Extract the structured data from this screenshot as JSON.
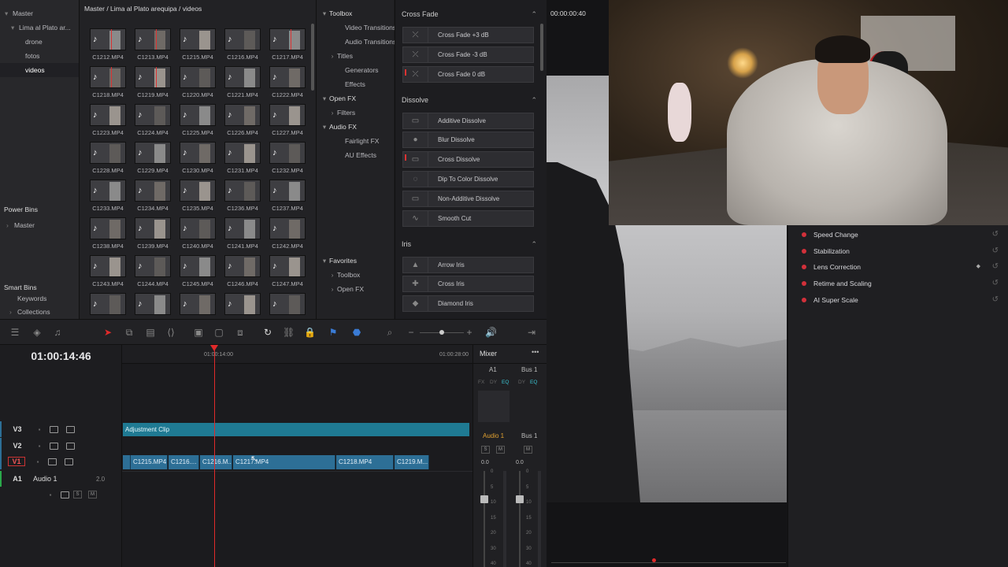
{
  "bins": {
    "items": [
      {
        "label": "Master",
        "level": 0,
        "chev": "▾"
      },
      {
        "label": "Lima al Plato ar...",
        "level": 1,
        "chev": "▾"
      },
      {
        "label": "drone",
        "level": 2,
        "chev": ""
      },
      {
        "label": "fotos",
        "level": 2,
        "chev": ""
      },
      {
        "label": "videos",
        "level": 2,
        "chev": "",
        "selected": true
      }
    ],
    "power_bins": "Power Bins",
    "power_master": "Master",
    "smart_bins": "Smart Bins",
    "keywords": "Keywords",
    "collections": "Collections"
  },
  "media": {
    "breadcrumb": "Master / Lima al Plato arequipa / videos",
    "clips": [
      "C1212.MP4",
      "C1213.MP4",
      "C1215.MP4",
      "C1216.MP4",
      "C1217.MP4",
      "C1218.MP4",
      "C1219.MP4",
      "C1220.MP4",
      "C1221.MP4",
      "C1222.MP4",
      "C1223.MP4",
      "C1224.MP4",
      "C1225.MP4",
      "C1226.MP4",
      "C1227.MP4",
      "C1228.MP4",
      "C1229.MP4",
      "C1230.MP4",
      "C1231.MP4",
      "C1232.MP4",
      "C1233.MP4",
      "C1234.MP4",
      "C1235.MP4",
      "C1236.MP4",
      "C1237.MP4",
      "C1238.MP4",
      "C1239.MP4",
      "C1240.MP4",
      "C1241.MP4",
      "C1242.MP4",
      "C1243.MP4",
      "C1244.MP4",
      "C1245.MP4",
      "C1246.MP4",
      "C1247.MP4",
      "",
      "",
      "",
      "",
      ""
    ]
  },
  "toolbox": {
    "items": [
      {
        "label": "Toolbox",
        "chev": "▾",
        "indent": 0
      },
      {
        "label": "Video Transitions",
        "chev": "",
        "indent": 2
      },
      {
        "label": "Audio Transitions",
        "chev": "",
        "indent": 2
      },
      {
        "label": "Titles",
        "chev": "›",
        "indent": 1
      },
      {
        "label": "Generators",
        "chev": "",
        "indent": 2
      },
      {
        "label": "Effects",
        "chev": "",
        "indent": 2
      },
      {
        "label": "Open FX",
        "chev": "▾",
        "indent": 0
      },
      {
        "label": "Filters",
        "chev": "›",
        "indent": 1
      },
      {
        "label": "Audio FX",
        "chev": "▾",
        "indent": 0
      },
      {
        "label": "Fairlight FX",
        "chev": "",
        "indent": 2
      },
      {
        "label": "AU Effects",
        "chev": "",
        "indent": 2
      }
    ],
    "favorites": [
      {
        "label": "Favorites",
        "chev": "▾",
        "indent": 0
      },
      {
        "label": "Toolbox",
        "chev": "›",
        "indent": 1
      },
      {
        "label": "Open FX",
        "chev": "›",
        "indent": 1
      }
    ]
  },
  "effects": {
    "sections": [
      {
        "title": "Cross Fade",
        "items": [
          {
            "label": "Cross Fade +3 dB",
            "icon": "⤫"
          },
          {
            "label": "Cross Fade -3 dB",
            "icon": "⤫"
          },
          {
            "label": "Cross Fade 0 dB",
            "icon": "⤫",
            "fav": true
          }
        ]
      },
      {
        "title": "Dissolve",
        "items": [
          {
            "label": "Additive Dissolve",
            "icon": "▭"
          },
          {
            "label": "Blur Dissolve",
            "icon": "●"
          },
          {
            "label": "Cross Dissolve",
            "icon": "▭",
            "fav": true
          },
          {
            "label": "Dip To Color Dissolve",
            "icon": "◌"
          },
          {
            "label": "Non-Additive Dissolve",
            "icon": "▭"
          },
          {
            "label": "Smooth Cut",
            "icon": "∿"
          }
        ]
      },
      {
        "title": "Iris",
        "items": [
          {
            "label": "Arrow Iris",
            "icon": "▲"
          },
          {
            "label": "Cross Iris",
            "icon": "✚"
          },
          {
            "label": "Diamond Iris",
            "icon": "◆"
          }
        ]
      }
    ]
  },
  "timeline": {
    "timecode": "01:00:14:46",
    "ruler_marks": [
      "01:00:14:00",
      "01:00:28:00"
    ],
    "tracks": [
      {
        "name": "V3",
        "label": ""
      },
      {
        "name": "V2",
        "label": ""
      },
      {
        "name": "V1",
        "label": ""
      },
      {
        "name": "A1",
        "label": "Audio 1",
        "value": "2.0"
      }
    ],
    "adjustment_clip": "Adjustment Clip",
    "clips": [
      "C1215.MP4",
      "C1216....",
      "C1216.M...",
      "C1217.MP4",
      "C1218.MP4",
      "C1219.M..."
    ],
    "audio_buttons": {
      "s": "S",
      "m": "M"
    }
  },
  "mixer": {
    "title": "Mixer",
    "menu": "•••",
    "a1": "A1",
    "bus1": "Bus 1",
    "fx": "FX",
    "dy": "DY",
    "eq": "EQ",
    "audio1": "Audio 1",
    "bus1b": "Bus 1",
    "s": "S",
    "m": "M",
    "vol": "0.0",
    "scale": [
      "0",
      "5",
      "10",
      "15",
      "20",
      "30",
      "40"
    ]
  },
  "viewer": {
    "timecode": "00:00:00:40"
  },
  "inspector": {
    "items": [
      "Speed Change",
      "Stabilization",
      "Lens Correction",
      "Retime and Scaling",
      "AI Super Scale"
    ]
  }
}
